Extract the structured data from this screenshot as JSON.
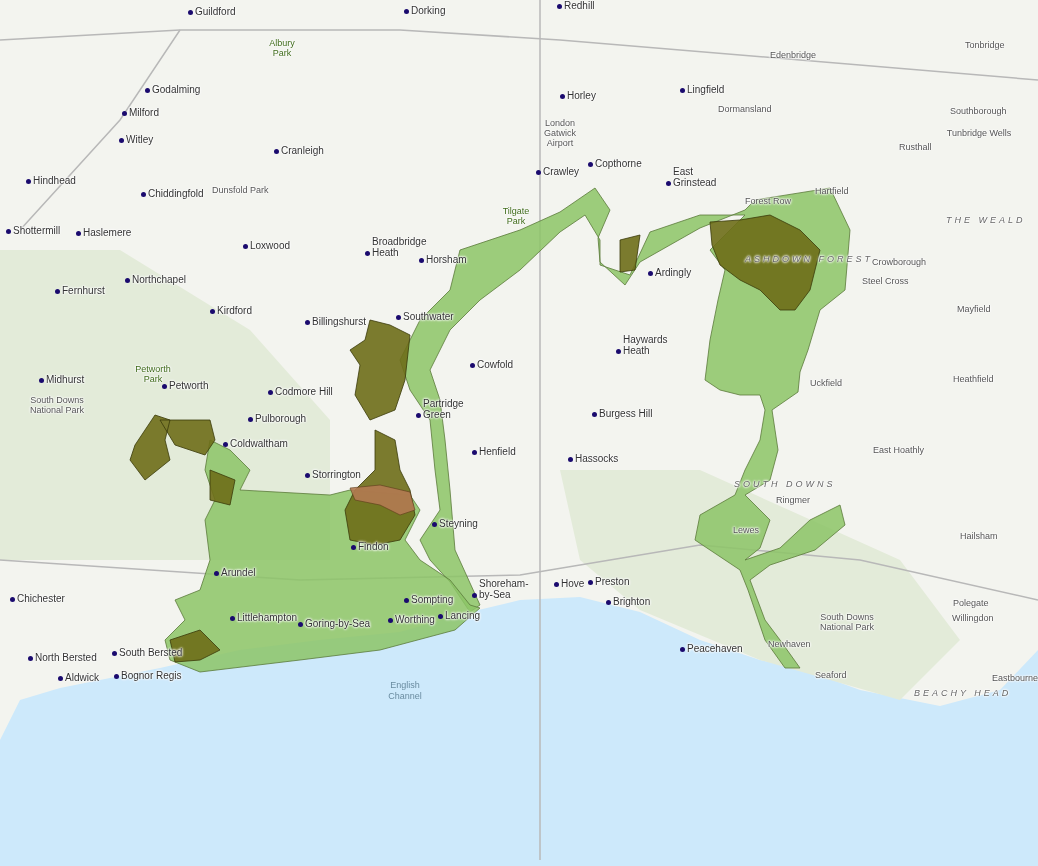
{
  "map": {
    "labels": [
      {
        "text": "Guildford",
        "kind": "town"
      },
      {
        "text": "Dorking",
        "kind": "town"
      },
      {
        "text": "Redhill",
        "kind": "town"
      },
      {
        "text": "Godalming",
        "kind": "town"
      },
      {
        "text": "Milford",
        "kind": "town"
      },
      {
        "text": "Witley",
        "kind": "town"
      },
      {
        "text": "Cranleigh",
        "kind": "town"
      },
      {
        "text": "Hindhead",
        "kind": "town"
      },
      {
        "text": "Chiddingfold",
        "kind": "town"
      },
      {
        "text": "Dunsfold Park",
        "kind": "area"
      },
      {
        "text": "Albury Park",
        "kind": "park"
      },
      {
        "text": "Shottermill",
        "kind": "town"
      },
      {
        "text": "Haslemere",
        "kind": "town"
      },
      {
        "text": "Loxwood",
        "kind": "town"
      },
      {
        "text": "Broadbridge Heath",
        "kind": "town"
      },
      {
        "text": "Horsham",
        "kind": "town"
      },
      {
        "text": "Northchapel",
        "kind": "town"
      },
      {
        "text": "Fernhurst",
        "kind": "town"
      },
      {
        "text": "Kirdford",
        "kind": "town"
      },
      {
        "text": "Billingshurst",
        "kind": "town"
      },
      {
        "text": "Southwater",
        "kind": "town"
      },
      {
        "text": "Horley",
        "kind": "town"
      },
      {
        "text": "London Gatwick Airport",
        "kind": "area"
      },
      {
        "text": "Copthorne",
        "kind": "town"
      },
      {
        "text": "Crawley",
        "kind": "town"
      },
      {
        "text": "Tilgate Park",
        "kind": "park"
      },
      {
        "text": "Lingfield",
        "kind": "town"
      },
      {
        "text": "Dormansland",
        "kind": "area"
      },
      {
        "text": "Edenbridge",
        "kind": "area"
      },
      {
        "text": "Tonbridge",
        "kind": "area"
      },
      {
        "text": "Southborough",
        "kind": "area"
      },
      {
        "text": "Tunbridge Wells",
        "kind": "area"
      },
      {
        "text": "Rusthall",
        "kind": "area"
      },
      {
        "text": "East Grinstead",
        "kind": "town"
      },
      {
        "text": "Forest Row",
        "kind": "area"
      },
      {
        "text": "Hartfield",
        "kind": "area"
      },
      {
        "text": "ASHDOWN FOREST",
        "kind": "region"
      },
      {
        "text": "THE WEALD",
        "kind": "region"
      },
      {
        "text": "Crowborough",
        "kind": "area"
      },
      {
        "text": "Steel Cross",
        "kind": "area"
      },
      {
        "text": "Mayfield",
        "kind": "area"
      },
      {
        "text": "Ardingly",
        "kind": "town"
      },
      {
        "text": "Haywards Heath",
        "kind": "town"
      },
      {
        "text": "Uckfield",
        "kind": "area"
      },
      {
        "text": "Heathfield",
        "kind": "area"
      },
      {
        "text": "Burgess Hill",
        "kind": "town"
      },
      {
        "text": "Hassocks",
        "kind": "town"
      },
      {
        "text": "East Hoathly",
        "kind": "area"
      },
      {
        "text": "SOUTH DOWNS",
        "kind": "region"
      },
      {
        "text": "Ringmer",
        "kind": "area"
      },
      {
        "text": "Lewes",
        "kind": "area"
      },
      {
        "text": "Hailsham",
        "kind": "area"
      },
      {
        "text": "Hove",
        "kind": "town"
      },
      {
        "text": "Preston",
        "kind": "town"
      },
      {
        "text": "Brighton",
        "kind": "town"
      },
      {
        "text": "Peacehaven",
        "kind": "town"
      },
      {
        "text": "Newhaven",
        "kind": "area"
      },
      {
        "text": "Seaford",
        "kind": "area"
      },
      {
        "text": "Polegate",
        "kind": "area"
      },
      {
        "text": "Willingdon",
        "kind": "area"
      },
      {
        "text": "Eastbourne",
        "kind": "area"
      },
      {
        "text": "BEACHY HEAD",
        "kind": "region"
      },
      {
        "text": "South Downs National Park",
        "kind": "area"
      },
      {
        "text": "Midhurst",
        "kind": "town"
      },
      {
        "text": "South Downs National Park",
        "kind": "area"
      },
      {
        "text": "Petworth Park",
        "kind": "park"
      },
      {
        "text": "Petworth",
        "kind": "town"
      },
      {
        "text": "Codmore Hill",
        "kind": "town"
      },
      {
        "text": "Pulborough",
        "kind": "town"
      },
      {
        "text": "Coldwaltham",
        "kind": "town"
      },
      {
        "text": "Storrington",
        "kind": "town"
      },
      {
        "text": "Cowfold",
        "kind": "town"
      },
      {
        "text": "Partridge Green",
        "kind": "town"
      },
      {
        "text": "Henfield",
        "kind": "town"
      },
      {
        "text": "Steyning",
        "kind": "town"
      },
      {
        "text": "Findon",
        "kind": "town"
      },
      {
        "text": "Arundel",
        "kind": "town"
      },
      {
        "text": "Chichester",
        "kind": "town"
      },
      {
        "text": "Littlehampton",
        "kind": "town"
      },
      {
        "text": "Goring-by-Sea",
        "kind": "town"
      },
      {
        "text": "Sompting",
        "kind": "town"
      },
      {
        "text": "Worthing",
        "kind": "town"
      },
      {
        "text": "Lancing",
        "kind": "town"
      },
      {
        "text": "Shoreham-by-Sea",
        "kind": "town"
      },
      {
        "text": "North Bersted",
        "kind": "town"
      },
      {
        "text": "South Bersted",
        "kind": "town"
      },
      {
        "text": "Aldwick",
        "kind": "town"
      },
      {
        "text": "Bognor Regis",
        "kind": "town"
      },
      {
        "text": "English Channel",
        "kind": "sea"
      }
    ]
  }
}
